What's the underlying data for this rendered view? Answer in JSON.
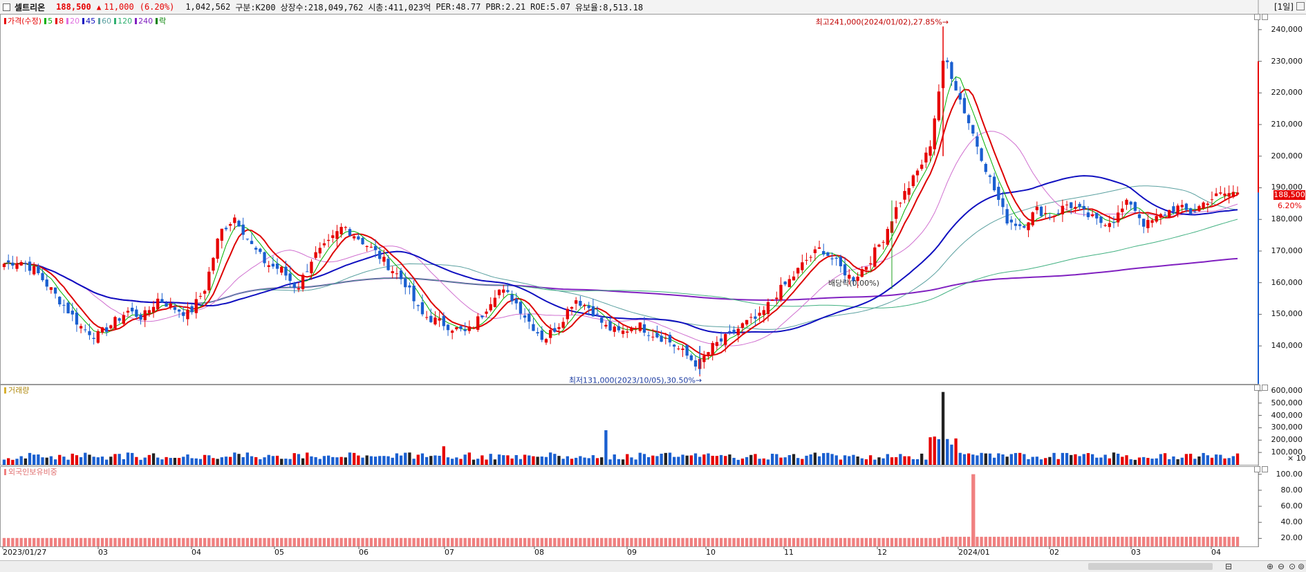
{
  "header": {
    "stock_name": "셀트리온",
    "price": "188,500",
    "change_arrow": "▲",
    "change": "11,000",
    "change_pct": "(6.20%)",
    "volume": "1,042,562",
    "category": "구분:K200",
    "shares": "상장수:218,049,762",
    "market_cap": "시총:411,023억",
    "per": "PER:48.77",
    "pbr": "PBR:2.21",
    "roe": "ROE:5.07",
    "float": "유보율:8,513.18",
    "period": "[1일]"
  },
  "legend": [
    {
      "label": "가격(수정)",
      "color": "#e60000"
    },
    {
      "label": "5",
      "color": "#00b000"
    },
    {
      "label": "8",
      "color": "#e60000"
    },
    {
      "label": "20",
      "color": "#e070e0"
    },
    {
      "label": "45",
      "color": "#1010c0"
    },
    {
      "label": "60",
      "color": "#5aa0a0"
    },
    {
      "label": "120",
      "color": "#30b070"
    },
    {
      "label": "240",
      "color": "#8020c0"
    },
    {
      "label": "락",
      "color": "#008000"
    }
  ],
  "colors": {
    "up": "#e60000",
    "down": "#1a5fd0",
    "ma5": "#00b000",
    "ma8": "#dd0000",
    "ma20": "#d070d0",
    "ma45": "#1010c0",
    "ma60": "#5aa0a0",
    "ma120": "#40b080",
    "ma240": "#8020c0",
    "foreign": "#f08080"
  },
  "price_axis": [
    "240,000",
    "230,000",
    "220,000",
    "210,000",
    "200,000",
    "190,000",
    "180,000",
    "170,000",
    "160,000",
    "150,000",
    "140,000"
  ],
  "price_tag": "188,500",
  "pct_tag": "6.20%",
  "annotations": {
    "high": "최고241,000(2024/01/02),27.85%→",
    "low": "최저131,000(2023/10/05),30.50%→",
    "lock": "배당락(0.00%)"
  },
  "volume_panel": {
    "label": "거래량",
    "axis": [
      "600,000",
      "500,000",
      "400,000",
      "300,000",
      "200,000",
      "100,000"
    ],
    "unit": "× 10"
  },
  "foreign_panel": {
    "label": "외국인보유비중",
    "axis": [
      "100.00",
      "80.00",
      "60.00",
      "40.00",
      "20.00"
    ]
  },
  "date_labels": [
    "2023/01/27",
    "03",
    "04",
    "05",
    "06",
    "07",
    "08",
    "09",
    "10",
    "11",
    "12",
    "2024/01",
    "02",
    "03",
    "04"
  ],
  "chart_data": {
    "type": "candlestick",
    "price_range": [
      131000,
      241000
    ],
    "price_ylim": [
      128000,
      245000
    ],
    "ticks_date": [
      "2023/01/27",
      "03",
      "04",
      "05",
      "06",
      "07",
      "08",
      "09",
      "10",
      "11",
      "12",
      "2024/01",
      "02",
      "03",
      "04"
    ],
    "close_path": [
      166000,
      167000,
      164000,
      158000,
      152000,
      146000,
      143000,
      147000,
      151000,
      149000,
      155000,
      152000,
      150000,
      158000,
      176000,
      181000,
      172000,
      166000,
      164000,
      158000,
      168000,
      172000,
      178000,
      174000,
      170000,
      165000,
      160000,
      150000,
      148000,
      146000,
      144000,
      150000,
      158000,
      155000,
      148000,
      142000,
      147000,
      155000,
      152000,
      146000,
      144000,
      147000,
      144000,
      142000,
      138000,
      134000,
      140000,
      143000,
      147000,
      149000,
      156000,
      161000,
      167000,
      171000,
      166000,
      161000,
      166000,
      174000,
      185000,
      193000,
      202000,
      232000,
      218000,
      205000,
      192000,
      180000,
      178000,
      183000,
      181000,
      185000,
      182000,
      179000,
      180000,
      186000,
      178000,
      181000,
      184000,
      182000,
      186000,
      188000,
      188500
    ],
    "high": {
      "value": 241000,
      "date": "2024/01/02",
      "pct": "27.85%"
    },
    "low": {
      "value": 131000,
      "date": "2023/10/05",
      "pct": "30.50%"
    },
    "last_close": 188500,
    "volume_peak": 590000,
    "foreign_spike": 100,
    "foreign_base": 22
  }
}
